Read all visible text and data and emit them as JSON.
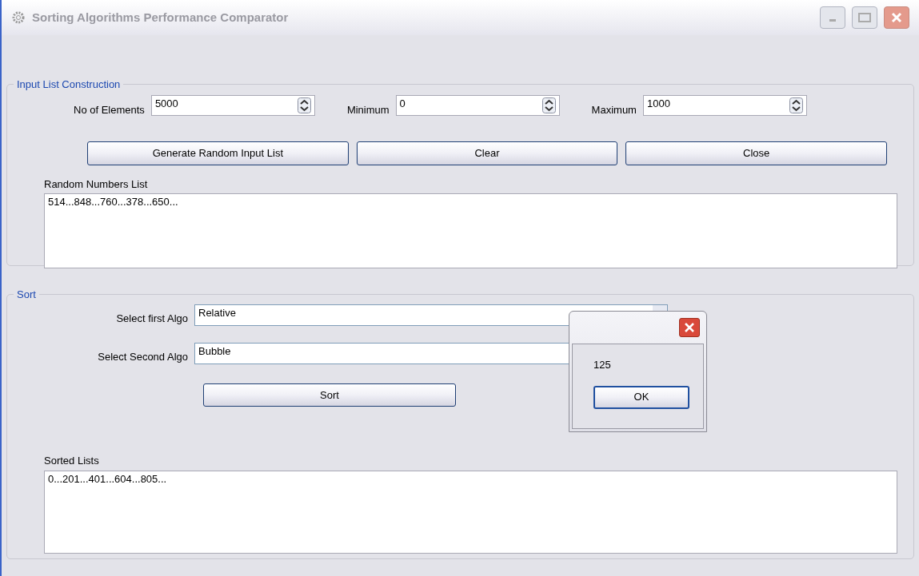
{
  "window": {
    "title": "Sorting Algorithms Performance Comparator"
  },
  "input_group": {
    "title": "Input List Construction",
    "spinners": [
      {
        "label": "No of Elements",
        "value": "5000"
      },
      {
        "label": "Minimum",
        "value": "0"
      },
      {
        "label": "Maximum",
        "value": "1000"
      }
    ],
    "buttons": [
      "Generate Random Input List",
      "Clear",
      "Close"
    ],
    "list_label": "Random Numbers List",
    "list_text": "514...848...760...378...650..."
  },
  "sort_group": {
    "title": "Sort",
    "combos": [
      {
        "label": "Select first Algo",
        "value": "Relative"
      },
      {
        "label": "Select Second Algo",
        "value": "Bubble"
      }
    ],
    "sort_button": "Sort",
    "list_label": "Sorted Lists",
    "list_text": "0...201...401...604...805..."
  },
  "message_box": {
    "message": "125",
    "button": "OK"
  }
}
